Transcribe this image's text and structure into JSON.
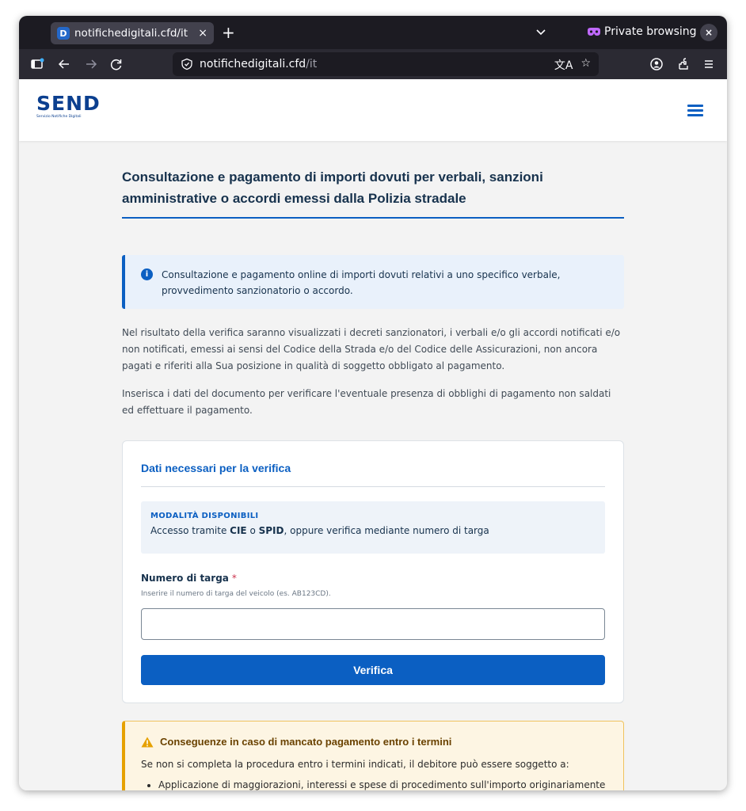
{
  "browser": {
    "tab_title": "notifichedigitali.cfd/it",
    "tab_favicon_letter": "D",
    "tab_close": "×",
    "new_tab": "+",
    "private_label": "Private browsing",
    "window_close": "×",
    "url_host": "notifichedigitali.cfd",
    "url_path": "/it",
    "icons": [
      "sidebar-icon",
      "back-icon",
      "forward-icon",
      "reload-icon",
      "shield-icon",
      "translate-icon",
      "bookmark-star-icon",
      "account-icon",
      "extensions-icon",
      "menu-icon"
    ]
  },
  "header": {
    "logo_word": "SEND",
    "logo_sub": "Servizio Notifiche Digitali"
  },
  "main": {
    "title": "Consultazione e pagamento di importi dovuti per verbali, sanzioni amministrative o accordi emessi dalla Polizia stradale",
    "info": "Consultazione e pagamento online di importi dovuti relativi a uno specifico verbale, provvedimento sanzionatorio o accordo.",
    "info_icon": "i",
    "paragraph1": "Nel risultato della verifica saranno visualizzati i decreti sanzionatori, i verbali e/o gli accordi notificati e/o non notificati, emessi ai sensi del Codice della Strada e/o del Codice delle Assicurazioni, non ancora pagati e riferiti alla Sua posizione in qualità di soggetto obbligato al pagamento.",
    "paragraph2": "Inserisca i dati del documento per verificare l'eventuale presenza di obblighi di pagamento non saldati ed effettuare il pagamento."
  },
  "form": {
    "card_title": "Dati necessari per la verifica",
    "modes_label": "MODALITÀ DISPONIBILI",
    "modes_prefix": "Accesso tramite ",
    "modes_cie": "CIE",
    "modes_or": " o ",
    "modes_spid": "SPID",
    "modes_suffix": ", oppure verifica mediante numero di targa",
    "field_label": "Numero di targa",
    "field_required": "*",
    "field_hint": "Inserire il numero di targa del veicolo (es. AB123CD).",
    "field_value": "",
    "submit_label": "Verifica"
  },
  "warning": {
    "title": "Conseguenze in caso di mancato pagamento entro i termini",
    "text": "Se non si completa la procedura entro i termini indicati, il debitore può essere soggetto a:",
    "items": [
      "Applicazione di maggiorazioni, interessi e spese di procedimento sull'importo originariamente dovuto."
    ]
  },
  "colors": {
    "brand": "#0b5fc2",
    "logo": "#0b3f8f",
    "warning_accent": "#e6a100"
  }
}
